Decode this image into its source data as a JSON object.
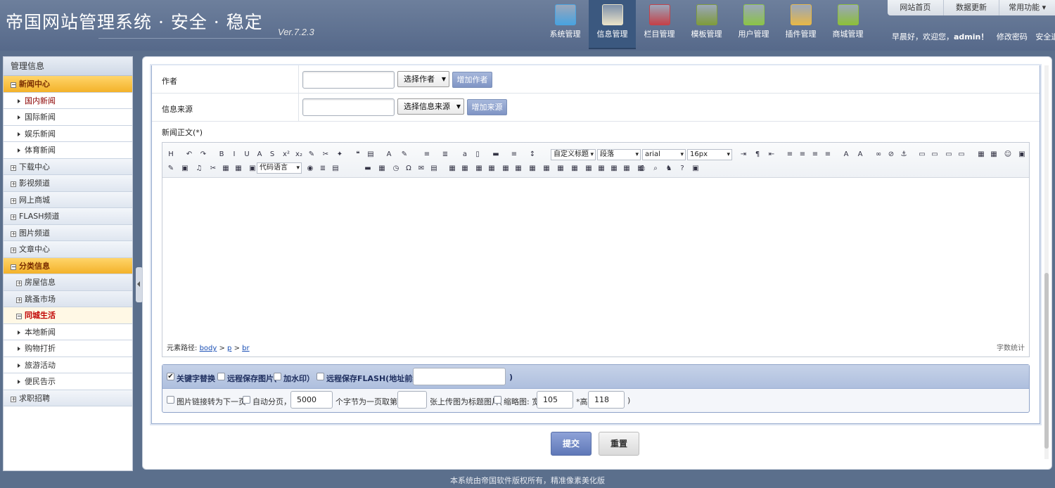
{
  "header": {
    "logo": "帝国网站管理系统 · 安全 · 稳定",
    "version": "Ver.7.2.3",
    "nav": [
      {
        "label": "系统管理",
        "icon": "monitor-icon",
        "color": "#4aa3df"
      },
      {
        "label": "信息管理",
        "icon": "notepad-icon",
        "color": "#e9e2c8",
        "active": true
      },
      {
        "label": "栏目管理",
        "icon": "book-icon",
        "color": "#c4424a"
      },
      {
        "label": "模板管理",
        "icon": "template-icon",
        "color": "#7f9c3e"
      },
      {
        "label": "用户管理",
        "icon": "cabinet-icon",
        "color": "#8cc34a"
      },
      {
        "label": "插件管理",
        "icon": "box-icon",
        "color": "#e6b84a"
      },
      {
        "label": "商城管理",
        "icon": "shopping-bag-icon",
        "color": "#8dbf3c"
      }
    ],
    "top_links": [
      "网站首页",
      "数据更新",
      "常用功能 ▾"
    ],
    "greeting": "早晨好，欢迎您，",
    "user": "admin！",
    "change_password": "修改密码",
    "logout": "安全退出"
  },
  "sidebar": {
    "title": "管理信息",
    "items": [
      {
        "label": "新闻中心",
        "type": "section-open",
        "mark": "⊟"
      },
      {
        "label": "国内新闻",
        "type": "sub",
        "selected": true
      },
      {
        "label": "国际新闻",
        "type": "sub"
      },
      {
        "label": "娱乐新闻",
        "type": "sub"
      },
      {
        "label": "体育新闻",
        "type": "sub"
      },
      {
        "label": "下载中心",
        "type": "section",
        "mark": "⊞"
      },
      {
        "label": "影视频道",
        "type": "section",
        "mark": "⊞"
      },
      {
        "label": "网上商城",
        "type": "section",
        "mark": "⊞"
      },
      {
        "label": "FLASH频道",
        "type": "section",
        "mark": "⊞"
      },
      {
        "label": "图片频道",
        "type": "section",
        "mark": "⊞"
      },
      {
        "label": "文章中心",
        "type": "section",
        "mark": "⊞"
      },
      {
        "label": "分类信息",
        "type": "section-open",
        "mark": "⊟"
      },
      {
        "label": "房屋信息",
        "type": "group",
        "mark": "⊞"
      },
      {
        "label": "跳蚤市场",
        "type": "group",
        "mark": "⊞"
      },
      {
        "label": "同城生活",
        "type": "group-open",
        "mark": "⊟"
      },
      {
        "label": "本地新闻",
        "type": "sub"
      },
      {
        "label": "购物打折",
        "type": "sub"
      },
      {
        "label": "旅游活动",
        "type": "sub"
      },
      {
        "label": "便民告示",
        "type": "sub"
      },
      {
        "label": "求职招聘",
        "type": "section",
        "mark": "⊞"
      }
    ]
  },
  "form": {
    "author_label": "作者",
    "author_value": "",
    "author_select": "选择作者",
    "author_add": "增加作者",
    "source_label": "信息来源",
    "source_value": "",
    "source_select": "选择信息来源",
    "source_add": "增加来源",
    "content_label": "新闻正文(*)"
  },
  "editor": {
    "toolbar_selects": [
      "自定义标题",
      "段落",
      "arial",
      "16px"
    ],
    "code_lang": "代码语言",
    "path_label": "元素路径:",
    "path": [
      "body",
      "p",
      "br"
    ],
    "word_count": "字数统计"
  },
  "options": {
    "keyword_replace": {
      "label": "关键字替换",
      "checked": true
    },
    "remote_save_img": "远程保存图片(",
    "watermark": "加水印）",
    "remote_save_flash": "远程保存FLASH(地址前缀:",
    "flash_prefix_value": "",
    "close_paren": ")",
    "img_link_next": "图片链接转为下一页",
    "auto_paging": "自动分页，每",
    "paging_chars": "5000",
    "chars_per_page": "个字节为一页",
    "take_nth": "取第",
    "nth_value": "",
    "as_title_pic": "张上传图为标题图片(",
    "thumb": "缩略图: 宽",
    "thumb_width": "105",
    "height_label": "*高",
    "thumb_height": "118",
    "close2": ")"
  },
  "buttons": {
    "submit": "提交",
    "reset": "重置"
  },
  "footer": "本系统由帝国软件版权所有，精准像素美化版"
}
